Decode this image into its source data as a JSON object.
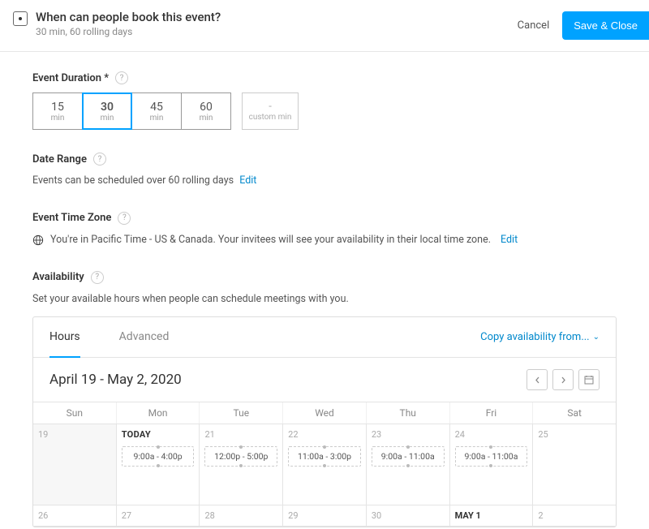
{
  "header": {
    "title": "When can people book this event?",
    "subtitle": "30 min, 60 rolling days",
    "cancel": "Cancel",
    "save": "Save & Close"
  },
  "duration": {
    "label": "Event Duration *",
    "options": [
      {
        "value": "15",
        "unit": "min"
      },
      {
        "value": "30",
        "unit": "min"
      },
      {
        "value": "45",
        "unit": "min"
      },
      {
        "value": "60",
        "unit": "min"
      }
    ],
    "selected_index": 1,
    "custom": {
      "placeholder": "-",
      "unit": "custom min"
    }
  },
  "date_range": {
    "label": "Date Range",
    "text": "Events can be scheduled over 60 rolling days",
    "edit": "Edit"
  },
  "timezone": {
    "label": "Event Time Zone",
    "text": "You're in Pacific Time - US & Canada. Your invitees will see your availability in their local time zone.",
    "edit": "Edit"
  },
  "availability": {
    "label": "Availability",
    "text": "Set your available hours when people can schedule meetings with you.",
    "tabs": {
      "hours": "Hours",
      "advanced": "Advanced"
    },
    "copy_link": "Copy availability from...",
    "range": "April 19 - May 2, 2020",
    "dow": [
      "Sun",
      "Mon",
      "Tue",
      "Wed",
      "Thu",
      "Fri",
      "Sat"
    ],
    "week1": [
      {
        "num": "19",
        "disabled": true
      },
      {
        "today": "TODAY",
        "slot": "9:00a - 4:00p"
      },
      {
        "num": "21",
        "slot": "12:00p - 5:00p"
      },
      {
        "num": "22",
        "slot": "11:00a - 3:00p"
      },
      {
        "num": "23",
        "slot": "9:00a - 11:00a"
      },
      {
        "num": "24",
        "slot": "9:00a - 11:00a"
      },
      {
        "num": "25"
      }
    ],
    "week2": [
      {
        "num": "26"
      },
      {
        "num": "27"
      },
      {
        "num": "28"
      },
      {
        "num": "29"
      },
      {
        "num": "30"
      },
      {
        "month": "MAY 1"
      },
      {
        "num": "2"
      }
    ]
  }
}
